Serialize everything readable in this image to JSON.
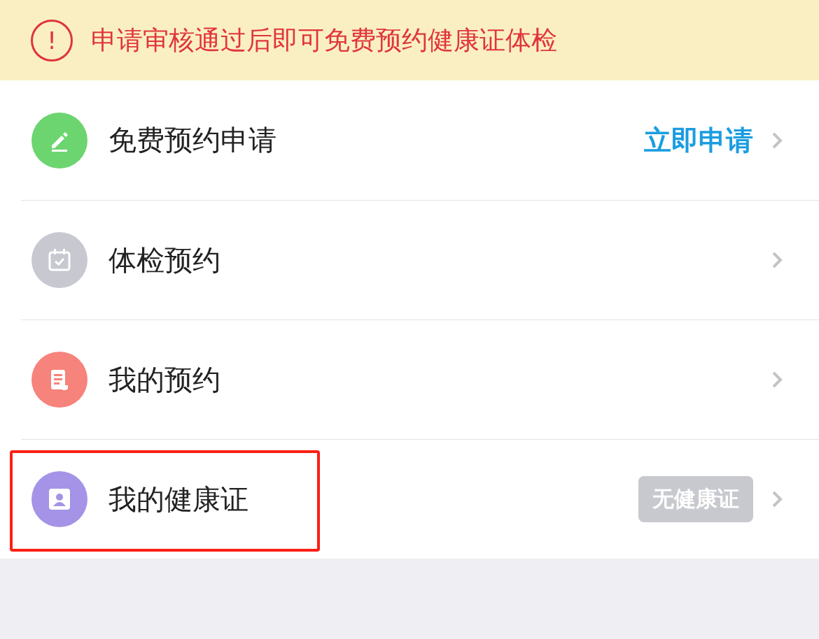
{
  "notice": {
    "icon": "!",
    "text": "申请审核通过后即可免费预约健康证体检"
  },
  "menu": [
    {
      "label": "免费预约申请",
      "kind": "action",
      "action": "立即申请",
      "color": "#6cd56f",
      "highlighted": false
    },
    {
      "label": "体检预约",
      "kind": "plain",
      "color": "#c7c8d0",
      "highlighted": false
    },
    {
      "label": "我的预约",
      "kind": "plain",
      "color": "#f6837c",
      "highlighted": false
    },
    {
      "label": "我的健康证",
      "kind": "badge",
      "badge": "无健康证",
      "color": "#a493e6",
      "highlighted": true
    }
  ]
}
